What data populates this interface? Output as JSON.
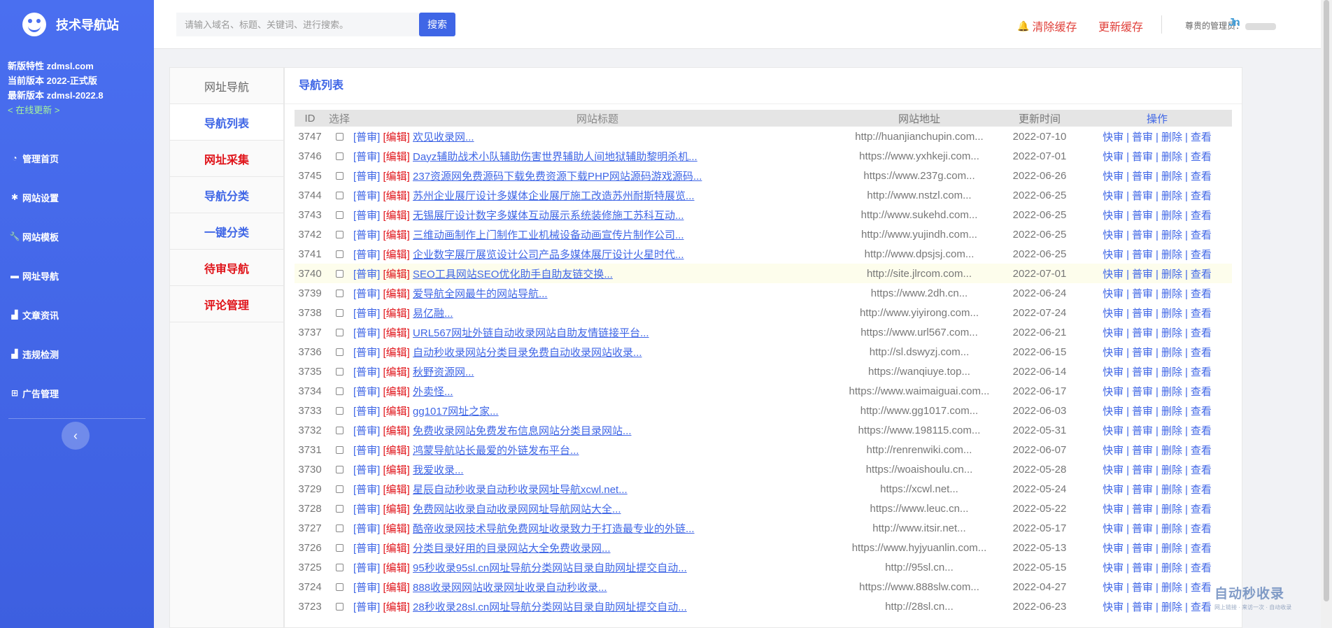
{
  "brand": {
    "name": "技术导航站"
  },
  "version": {
    "feature": "新版特性 zdmsl.com",
    "current": "当前版本 2022-正式版",
    "latest": "最新版本 zdmsl-2022.8",
    "update_link": "< 在线更新 >"
  },
  "sidebar": {
    "items": [
      {
        "label": "管理首页",
        "icon": "dashboard-icon"
      },
      {
        "label": "网站设置",
        "icon": "gear-icon"
      },
      {
        "label": "网站模板",
        "icon": "wrench-icon"
      },
      {
        "label": "网址导航",
        "icon": "folder-icon"
      },
      {
        "label": "文章资讯",
        "icon": "bar-chart-icon"
      },
      {
        "label": "违规检测",
        "icon": "bar-chart-icon"
      },
      {
        "label": "广告管理",
        "icon": "grid-icon"
      }
    ],
    "collapse_glyph": "‹"
  },
  "header": {
    "search_placeholder": "请输入域名、标题、关键词、进行搜索。",
    "search_button": "搜索",
    "clear_cache": "清除缓存",
    "update_cache": "更新缓存",
    "admin_label": "尊贵的管理员：",
    "admin_mark": "Jn"
  },
  "subnav": {
    "title": "网址导航",
    "items": [
      {
        "label": "导航列表",
        "color": "blue"
      },
      {
        "label": "网址采集",
        "color": "red"
      },
      {
        "label": "导航分类",
        "color": "blue"
      },
      {
        "label": "一键分类",
        "color": "blue"
      },
      {
        "label": "待审导航",
        "color": "red"
      },
      {
        "label": "评论管理",
        "color": "red"
      }
    ]
  },
  "main": {
    "title": "导航列表",
    "columns": [
      "ID",
      "选择",
      "网站标题",
      "网站地址",
      "更新时间",
      "操作"
    ],
    "tags": {
      "audit": "[普审]",
      "edit": "[编辑]"
    },
    "ops": [
      "快审",
      "普审",
      "删除",
      "查看"
    ],
    "op_sep": "|",
    "rows": [
      {
        "id": "3747",
        "title": "欢见收录网...",
        "url": "http://huanjianchupin.com...",
        "time": "2022-07-10"
      },
      {
        "id": "3746",
        "title": "Dayz辅助战术小队辅助伤害世界辅助人间地狱辅助黎明杀机...",
        "url": "https://www.yxhkeji.com...",
        "time": "2022-07-01"
      },
      {
        "id": "3745",
        "title": "237资源网免费源码下载免费资源下载PHP网站源码游戏源码...",
        "url": "https://www.237g.com...",
        "time": "2022-06-26"
      },
      {
        "id": "3744",
        "title": "苏州企业展厅设计多媒体企业展厅施工改造苏州耐斯特展览...",
        "url": "http://www.nstzl.com...",
        "time": "2022-06-25"
      },
      {
        "id": "3743",
        "title": "无锡展厅设计数字多媒体互动展示系统装修施工苏科互动...",
        "url": "http://www.sukehd.com...",
        "time": "2022-06-25"
      },
      {
        "id": "3742",
        "title": "三维动画制作上门制作工业机械设备动画宣传片制作公司...",
        "url": "http://www.yujindh.com...",
        "time": "2022-06-25"
      },
      {
        "id": "3741",
        "title": "企业数字展厅展览设计公司产品多媒体展厅设计火星时代...",
        "url": "http://www.dpsjsj.com...",
        "time": "2022-06-25"
      },
      {
        "id": "3740",
        "title": "SEO工具网站SEO优化助手自助友链交换...",
        "url": "http://site.jlrcom.com...",
        "time": "2022-07-01",
        "highlight": true
      },
      {
        "id": "3739",
        "title": "爱导航全网最牛的网站导航...",
        "url": "https://www.2dh.cn...",
        "time": "2022-06-24"
      },
      {
        "id": "3738",
        "title": "易亿融...",
        "url": "http://www.yiyirong.com...",
        "time": "2022-07-24"
      },
      {
        "id": "3737",
        "title": "URL567网址外链自动收录网站自助友情链接平台...",
        "url": "https://www.url567.com...",
        "time": "2022-06-21"
      },
      {
        "id": "3736",
        "title": "自动秒收录网站分类目录免费自动收录网站收录...",
        "url": "http://sl.dswyzj.com...",
        "time": "2022-06-15"
      },
      {
        "id": "3735",
        "title": "秋野资源网...",
        "url": "https://wanqiuye.top...",
        "time": "2022-06-14"
      },
      {
        "id": "3734",
        "title": "外卖怪...",
        "url": "https://www.waimaiguai.com...",
        "time": "2022-06-17"
      },
      {
        "id": "3733",
        "title": "gg1017网址之家...",
        "url": "http://www.gg1017.com...",
        "time": "2022-06-03"
      },
      {
        "id": "3732",
        "title": "免费收录网站免费发布信息网站分类目录网站...",
        "url": "https://www.198115.com...",
        "time": "2022-05-31"
      },
      {
        "id": "3731",
        "title": "鸿蒙导航站长最爱的外链发布平台...",
        "url": "http://renrenwiki.com...",
        "time": "2022-06-07"
      },
      {
        "id": "3730",
        "title": "我爱收录...",
        "url": "https://woaishoulu.cn...",
        "time": "2022-05-28"
      },
      {
        "id": "3729",
        "title": "星辰自动秒收录自动秒收录网址导航xcwl.net...",
        "url": "https://xcwl.net...",
        "time": "2022-05-24"
      },
      {
        "id": "3728",
        "title": "免费网站收录自动收录网网址导航网站大全...",
        "url": "https://www.leuc.cn...",
        "time": "2022-05-22"
      },
      {
        "id": "3727",
        "title": "酷帝收录网技术导航免费网址收录致力于打造最专业的外链...",
        "url": "http://www.itsir.net...",
        "time": "2022-05-17"
      },
      {
        "id": "3726",
        "title": "分类目录好用的目录网站大全免费收录网...",
        "url": "https://www.hyjyuanlin.com...",
        "time": "2022-05-13"
      },
      {
        "id": "3725",
        "title": "95秒收录95sl.cn网址导航分类网站目录自助网址提交自动...",
        "url": "http://95sl.cn...",
        "time": "2022-05-15"
      },
      {
        "id": "3724",
        "title": "888收录网网站收录网址收录自动秒收录...",
        "url": "https://www.888slw.com...",
        "time": "2022-04-27"
      },
      {
        "id": "3723",
        "title": "28秒收录28sl.cn网址导航分类网站目录自助网址提交自动...",
        "url": "http://28sl.cn...",
        "time": "2022-06-23"
      }
    ]
  },
  "watermark": {
    "main": "自动秒收录",
    "sub": "网上链接 · 来访一次 · 自动收录"
  },
  "colors": {
    "sidebar": "#4a6ff0",
    "accent": "#3f66e6",
    "danger": "#e0141a"
  }
}
